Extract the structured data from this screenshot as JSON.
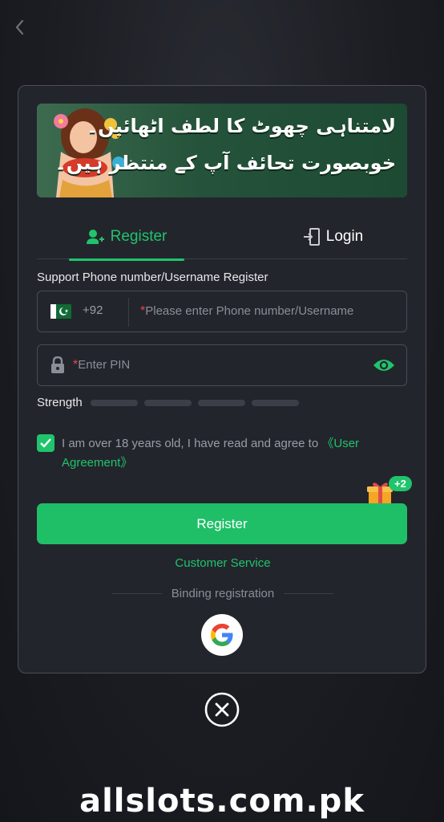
{
  "banner": {
    "line1": "لامتناہی چھوٹ کا لطف اٹھائیں۔",
    "line2": "خوبصورت تحائف آپ کے منتظر ہیں۔"
  },
  "tabs": [
    {
      "label": "Register",
      "icon": "add-user-icon",
      "active": true
    },
    {
      "label": "Login",
      "icon": "login-door-icon",
      "active": false
    }
  ],
  "form": {
    "support_label": "Support Phone number/Username Register",
    "country_code": "+92",
    "phone_required_mark": "*",
    "phone_placeholder": "Please enter Phone number/Username",
    "pin_required_mark": "*",
    "pin_placeholder": "Enter PIN",
    "strength_label": "Strength",
    "agree_text": "I am over 18 years old, I have read and agree to",
    "agree_link": "《User Agreement》",
    "agree_checked": true,
    "gift_badge": "+2",
    "register_button": "Register",
    "customer_service": "Customer Service",
    "binding_label": "Binding registration"
  },
  "footer": {
    "watermark": "allslots.com.pk"
  },
  "colors": {
    "accent": "#1fc46c",
    "background": "#1a1c22",
    "modal": "#23252c",
    "required": "#e24a4a"
  }
}
